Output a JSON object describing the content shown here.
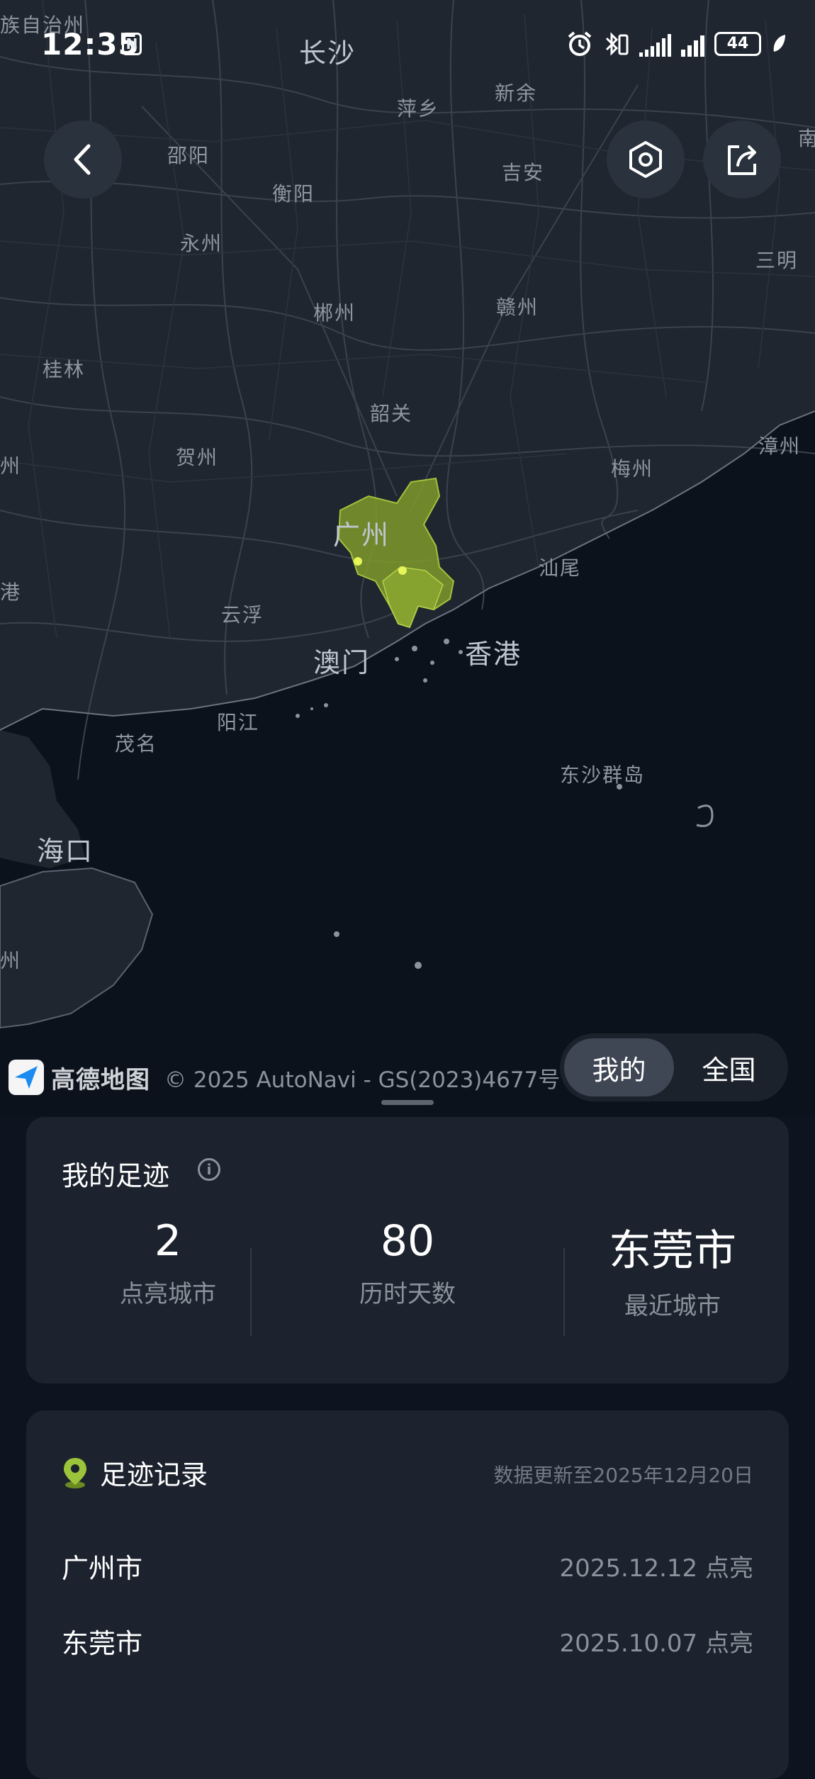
{
  "status_bar": {
    "time": "12:35",
    "nfc": "N",
    "battery": "44"
  },
  "map": {
    "labels": {
      "changsha": "长沙",
      "pingxiang": "萍乡",
      "xinyu": "新余",
      "shaoyang": "邵阳",
      "hengyang": "衡阳",
      "jian": "吉安",
      "yongzhou": "永州",
      "sanming": "三明",
      "chenzhou": "郴州",
      "ganzhou": "赣州",
      "guilin": "桂林",
      "shaoguan": "韶关",
      "zhangzhou": "漳州",
      "hezhou": "贺州",
      "meizhou": "梅州",
      "guangzhou": "广州",
      "shanwei": "汕尾",
      "yunfu": "云浮",
      "macau": "澳门",
      "hongkong": "香港",
      "yangjiang": "阳江",
      "maoming": "茂名",
      "dongsha": "东沙群岛",
      "haikou": "海口",
      "topleft": "族自治州",
      "left_gang": "港",
      "left_zhou": "州",
      "left_zhou2": "州",
      "right_nan": "南"
    },
    "highlight_color": "#7f9a2a",
    "attribution_logo": "高德地图",
    "copyright": "© 2025 AutoNavi - GS(2023)4677号"
  },
  "toggle": {
    "mine": "我的",
    "all": "全国"
  },
  "footprint": {
    "title": "我的足迹",
    "stats": [
      {
        "value": "2",
        "label": "点亮城市"
      },
      {
        "value": "80",
        "label": "历时天数"
      },
      {
        "value": "东莞市",
        "label": "最近城市"
      }
    ]
  },
  "records": {
    "title": "足迹记录",
    "update_note": "数据更新至2025年12月20日",
    "items": [
      {
        "city": "广州市",
        "date": "2025.12.12 点亮"
      },
      {
        "city": "东莞市",
        "date": "2025.10.07 点亮"
      }
    ]
  }
}
